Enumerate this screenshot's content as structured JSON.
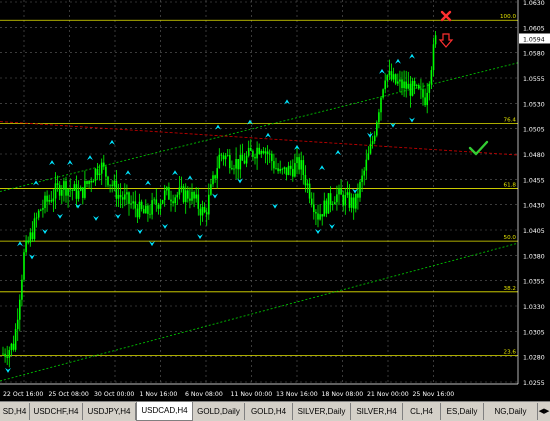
{
  "chart": {
    "price_ticks": [
      "1.0630",
      "1.0605",
      "1.0580",
      "1.0555",
      "1.0530",
      "1.0505",
      "1.0480",
      "1.0455",
      "1.0430",
      "1.0405",
      "1.0380",
      "1.0355",
      "1.0330",
      "1.0305",
      "1.0280",
      "1.0255"
    ],
    "current_price": "1.0594",
    "time_ticks": [
      "22 Oct 16:00",
      "25 Oct 08:00",
      "30 Oct 00:00",
      "1 Nov 16:00",
      "6 Nov 08:00",
      "11 Nov 00:00",
      "13 Nov 16:00",
      "18 Nov 08:00",
      "21 Nov 00:00",
      "25 Nov 16:00"
    ],
    "fib_levels": [
      {
        "label": "100.0",
        "price": 1.0612
      },
      {
        "label": "76.4",
        "price": 1.051
      },
      {
        "label": "61.8",
        "price": 1.0446
      },
      {
        "label": "50.0",
        "price": 1.0394
      },
      {
        "label": "38.2",
        "price": 1.0344
      },
      {
        "label": "23.6",
        "price": 1.0281
      }
    ],
    "colors": {
      "candles": "#00ff00",
      "fib_lines": "#e6e600",
      "fib_labels": "#e6e600",
      "grid": "#606060",
      "channel_lines": "#00c000",
      "trend_line": "#c00000",
      "signal_arrows": "#00e5ff",
      "sell_marker": "#ff3030",
      "check_mark": "#33cc33"
    },
    "icons": [
      "sell-cross-icon",
      "down-arrow-icon",
      "checkmark-icon",
      "signal-arrow-icon"
    ]
  },
  "tabs": [
    {
      "label": "SD,H4",
      "active": false
    },
    {
      "label": "USDCHF,H4",
      "active": false
    },
    {
      "label": "USDJPY,H4",
      "active": false
    },
    {
      "label": "USDCAD,H4",
      "active": true
    },
    {
      "label": "GOLD,Daily",
      "active": false
    },
    {
      "label": "GOLD,H4",
      "active": false
    },
    {
      "label": "SILVER,Daily",
      "active": false
    },
    {
      "label": "SILVER,H4",
      "active": false
    },
    {
      "label": "CL,H4",
      "active": false
    },
    {
      "label": "ES,Daily",
      "active": false
    },
    {
      "label": "NG,Daily",
      "active": false
    }
  ]
}
